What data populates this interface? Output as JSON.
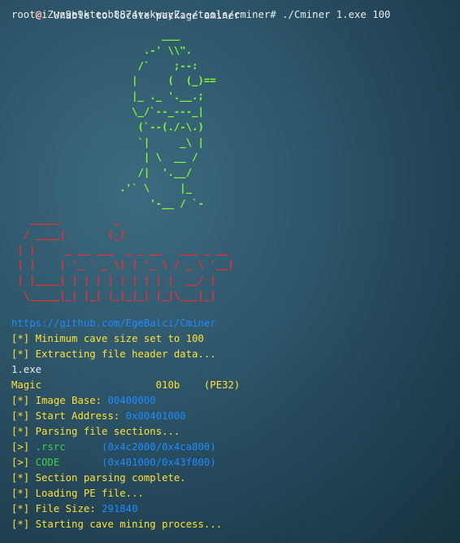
{
  "error_line": {
    "prefix": "E:",
    "text": " Unable to locate package aminer"
  },
  "prompt_line": "root@iZwz9e9kteob8874vxkwuyZ:~/tools/cminer# ./Cminer 1.exe 100",
  "ascii_gopher": "                         ___\n                      .-' \\\\\".\n                     /`    ;--:\n                    |     (  (_)==\n                    |_ ._ '.__.;\n                    \\_/`--_---_|\n                     (`--(./-\\.)\n                     `|     _\\ |\n                      | \\  __ /\n                     /|  '.__/\n                  .'` \\     |_\n                       '-__ / `-",
  "ascii_logo": "   _____         _\n  / ____|       (_)\n | |     _ __ ___  _ _ __   ___ _ __\n | |    | '_ ` _ \\| | '_ \\ / _ \\ '__|\n | |____| | | | | | | | | |  __/ |\n  \\_____|_| |_| |_|_|_| |_|\\___|_|",
  "url": "https://github.com/EgeBalci/Cminer",
  "output": [
    {
      "prefix": "[*]",
      "text": " Minimum cave size set to 100",
      "value": ""
    },
    {
      "prefix": "[*]",
      "text": " Extracting file header data...",
      "value": ""
    },
    {
      "prefix": "",
      "text": "1.exe",
      "value": ""
    },
    {
      "prefix": "",
      "text": "Magic                   010b    (PE32)",
      "value": ""
    },
    {
      "prefix": "[*]",
      "text": " Image Base: ",
      "value": "00400000"
    },
    {
      "prefix": "[*]",
      "text": " Start Address: ",
      "value": "0x00401000"
    },
    {
      "prefix": "[*]",
      "text": " Parsing file sections...",
      "value": ""
    },
    {
      "prefix": "[>]",
      "text": " .rsrc      ",
      "value": "(0x4c2000/0x4ca800)"
    },
    {
      "prefix": "[>]",
      "text": " CODE       ",
      "value": "(0x401000/0x43f800)"
    },
    {
      "prefix": "[*]",
      "text": " Section parsing complete.",
      "value": ""
    },
    {
      "prefix": "[*]",
      "text": " Loading PE file...",
      "value": ""
    },
    {
      "prefix": "[*]",
      "text": " File Size: ",
      "value": "291840"
    },
    {
      "prefix": "[*]",
      "text": " Starting cave mining process...",
      "value": ""
    }
  ],
  "colors": {
    "error": "#ff3b3b",
    "info": "#ffe033",
    "value": "#1f8bff",
    "section": "#3fd13f",
    "art_gopher": "#7dff2e",
    "art_logo": "#ff2a2a"
  }
}
